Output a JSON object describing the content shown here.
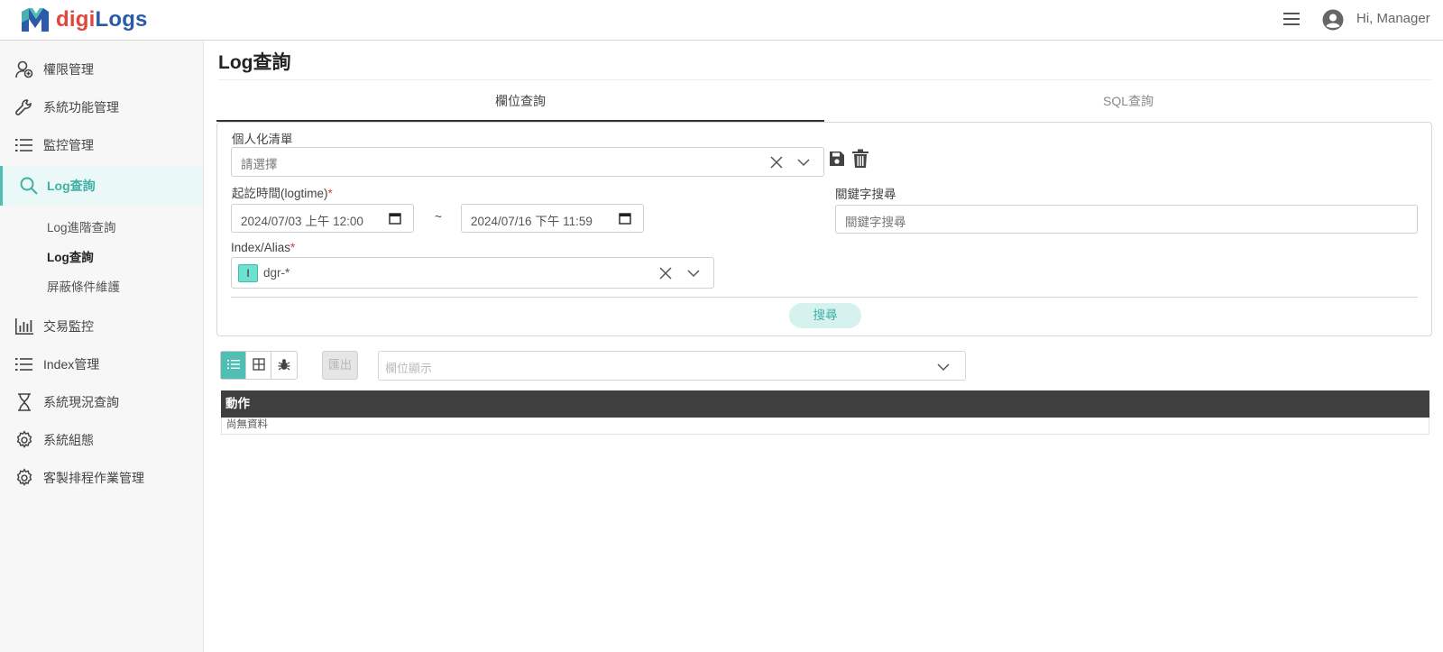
{
  "header": {
    "logo_part1": "digi",
    "logo_part2": "Logs",
    "user_greeting": "Hi, Manager"
  },
  "sidebar": {
    "items": [
      {
        "label": "權限管理",
        "icon": "users-icon"
      },
      {
        "label": "系統功能管理",
        "icon": "wrench-icon"
      },
      {
        "label": "監控管理",
        "icon": "list-icon"
      },
      {
        "label": "Log查詢",
        "icon": "search-icon"
      },
      {
        "label": "交易監控",
        "icon": "bar-chart-icon"
      },
      {
        "label": "Index管理",
        "icon": "list-icon"
      },
      {
        "label": "系統現況查詢",
        "icon": "hourglass-icon"
      },
      {
        "label": "系統組態",
        "icon": "gear-icon"
      },
      {
        "label": "客製排程作業管理",
        "icon": "gear-icon"
      }
    ],
    "sub_items": [
      {
        "label": "Log進階查詢"
      },
      {
        "label": "Log查詢"
      },
      {
        "label": "屏蔽條件維護"
      }
    ]
  },
  "main": {
    "title": "Log查詢",
    "tabs": [
      {
        "label": "欄位查詢"
      },
      {
        "label": "SQL查詢"
      }
    ],
    "form": {
      "personal_list_label": "個人化清單",
      "personal_list_placeholder": "請選擇",
      "time_label": "起訖時間(logtime)",
      "required_mark": "*",
      "start_time": "2024/07/03 上午 12:00",
      "tilde": "~",
      "end_time": "2024/07/16 下午 11:59",
      "keyword_label": "關鍵字搜尋",
      "keyword_placeholder": "關鍵字搜尋",
      "index_label": "Index/Alias",
      "index_tag": "I",
      "index_value": "dgr-*",
      "search_button": "搜尋"
    },
    "toolbar": {
      "export_button": "匯出",
      "column_display_placeholder": "欄位顯示"
    },
    "table": {
      "header": "動作",
      "empty_text": "尚無資料"
    }
  },
  "colors": {
    "accent": "#4fbfb3",
    "brand_red": "#e2463c",
    "brand_blue": "#2b5ba8",
    "table_header": "#3f3f3f"
  }
}
